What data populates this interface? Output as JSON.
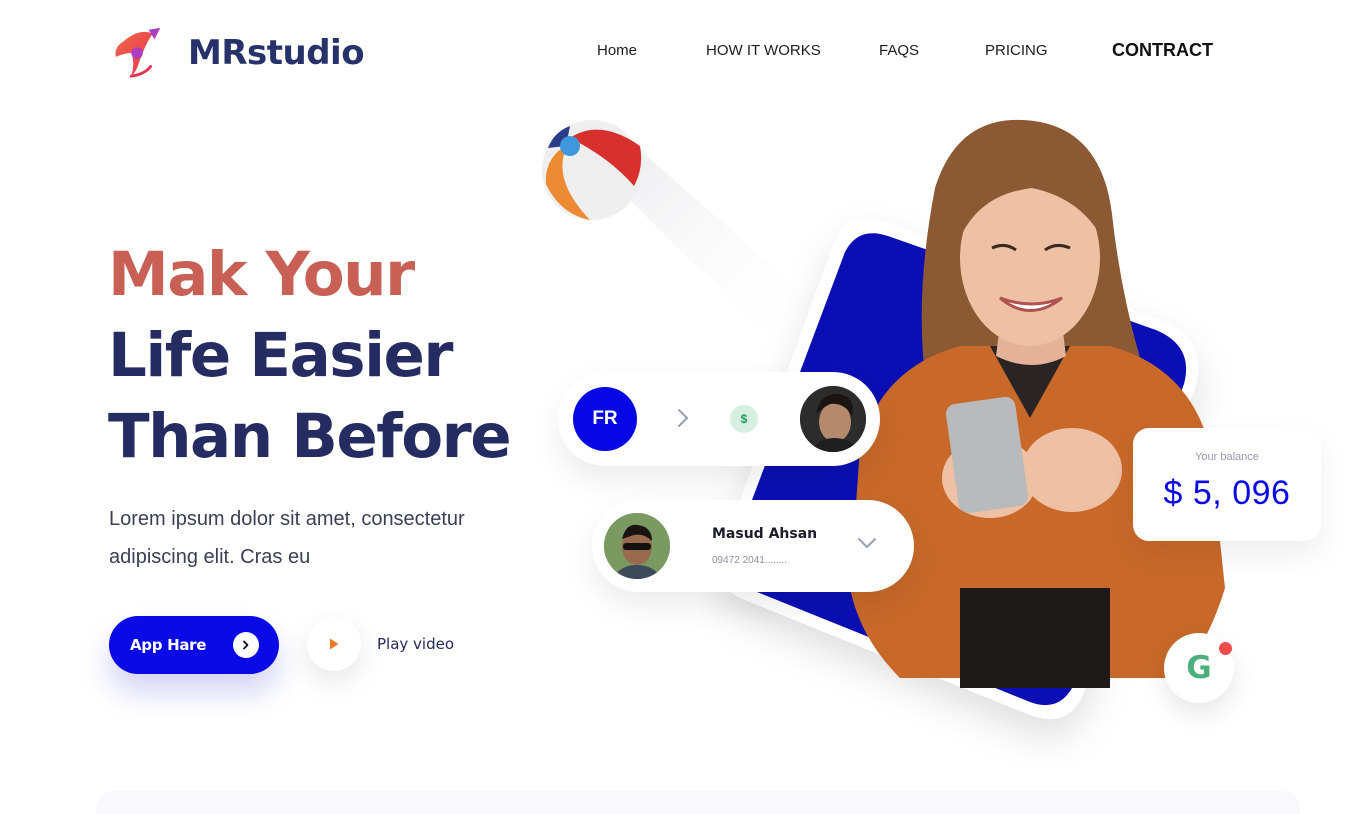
{
  "brand": {
    "name": "MRstudio",
    "logo_icon": "brand-logo-icon"
  },
  "nav": {
    "items": [
      {
        "label": "Home"
      },
      {
        "label": "HOW IT WORKS"
      },
      {
        "label": "FAQS"
      },
      {
        "label": "PRICING"
      },
      {
        "label": "CONTRACT",
        "active": true
      }
    ]
  },
  "hero": {
    "title_line1": "Mak Your",
    "title_line2": "Life Easier",
    "title_line3": "Than Before",
    "description": "Lorem ipsum dolor sit amet, consectetur adipiscing elit. Cras eu",
    "primary_button": "App Hare",
    "play_label": "Play video"
  },
  "transfer": {
    "initials": "FR",
    "currency_symbol": "$"
  },
  "contact": {
    "name": "Masud Ahsan",
    "phone": "09472 2041........"
  },
  "balance": {
    "label": "Your balance",
    "value": "$ 5, 096"
  },
  "badge": {
    "letter": "G"
  },
  "colors": {
    "accent_blue": "#0a0ae6",
    "title_red": "#c96055",
    "title_navy": "#242c61",
    "badge_green": "#4cb07a",
    "notify_red": "#ef4d4d"
  }
}
